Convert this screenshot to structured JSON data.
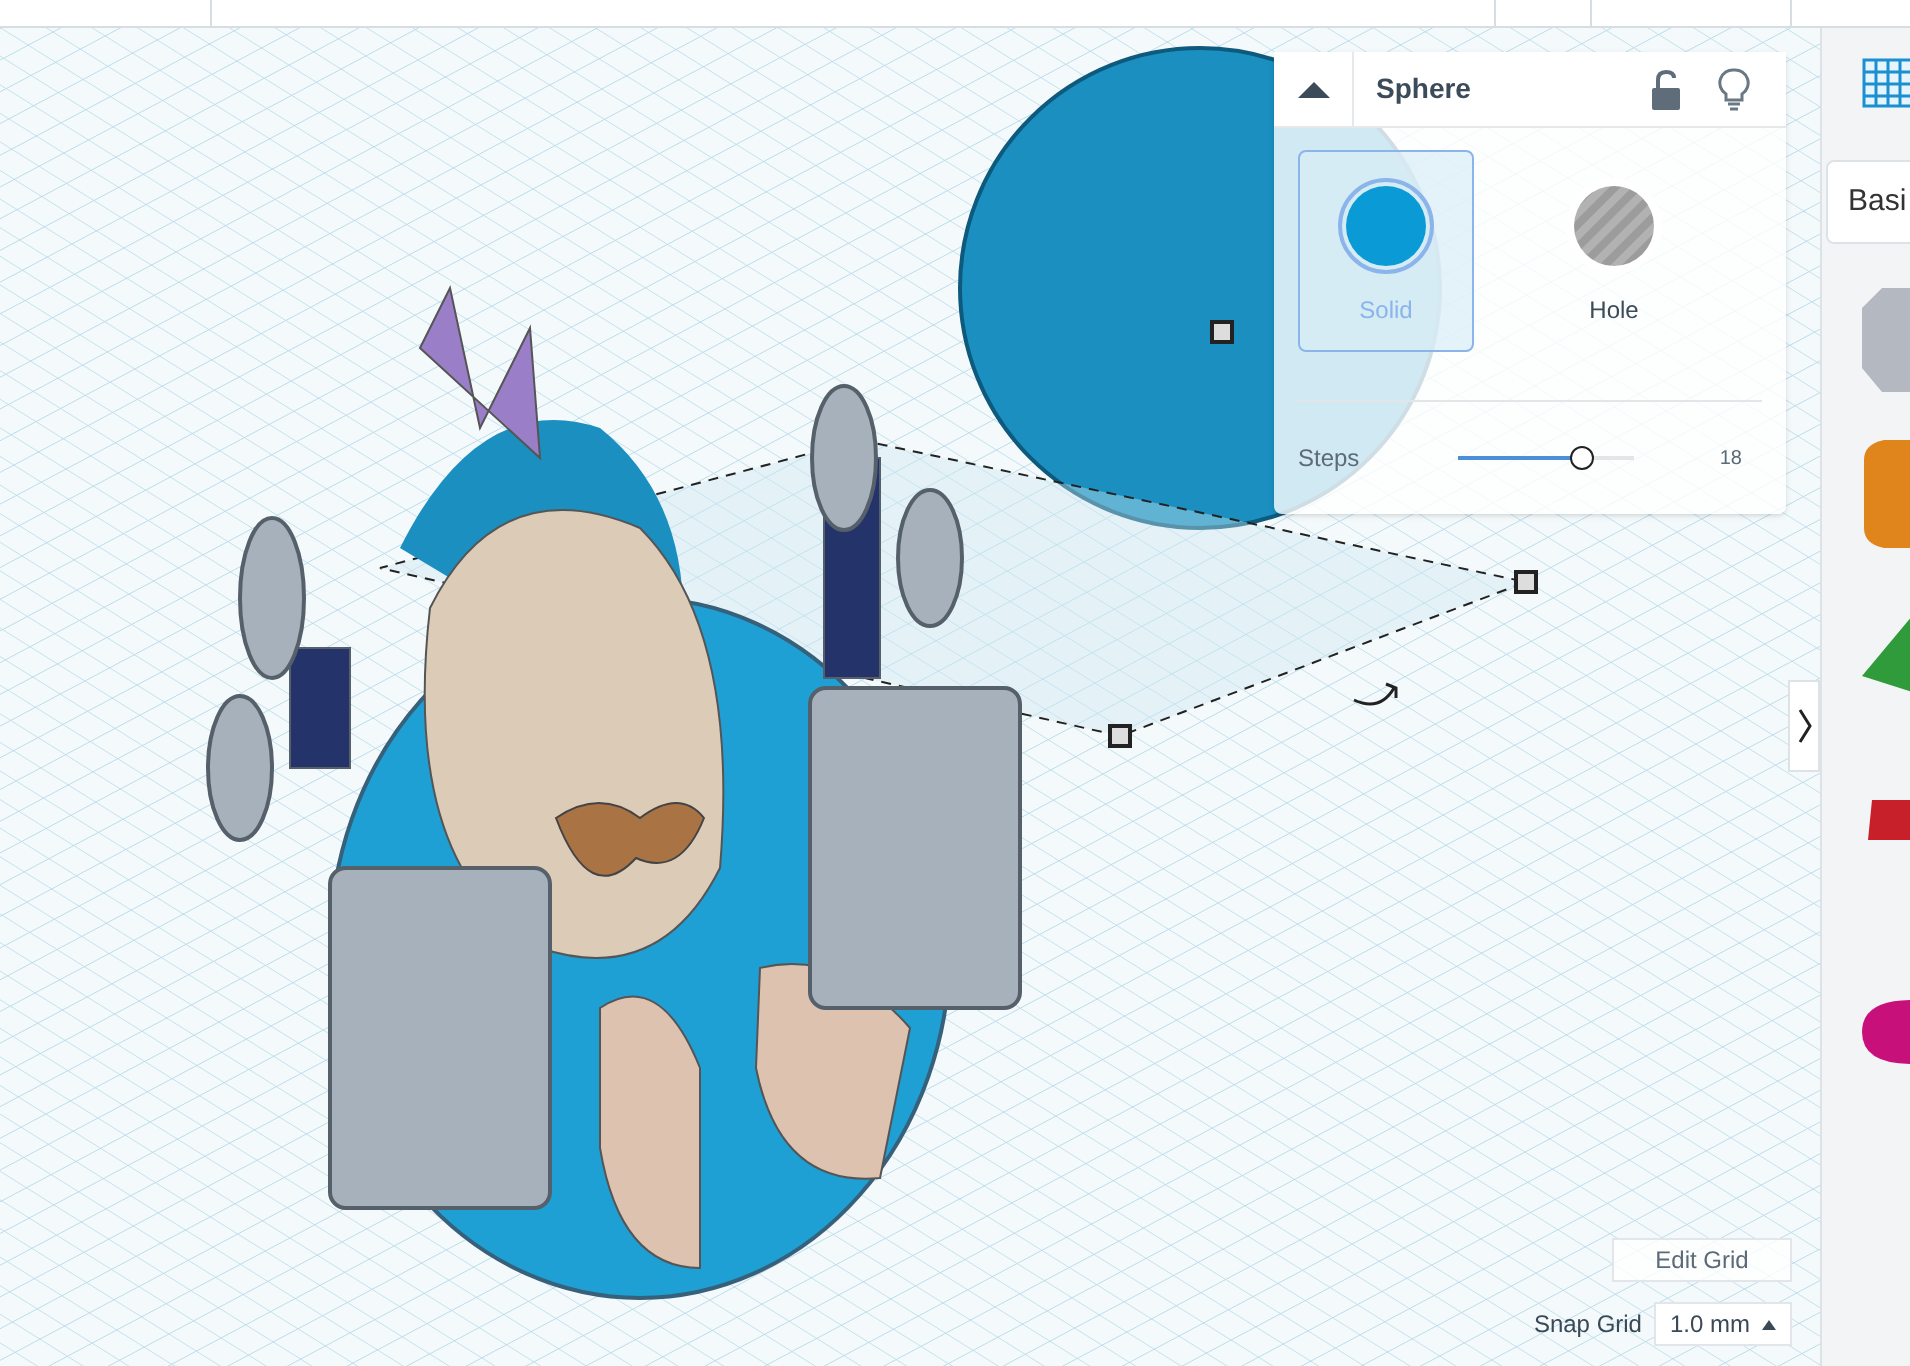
{
  "inspector": {
    "title": "Sphere",
    "collapsed": false,
    "locked": false,
    "options": [
      {
        "label": "Solid",
        "kind": "solid",
        "selected": true
      },
      {
        "label": "Hole",
        "kind": "hole",
        "selected": false
      }
    ],
    "steps": {
      "label": "Steps",
      "level": 0.71,
      "reading": "18"
    }
  },
  "library": {
    "category": "Basi"
  },
  "grid": {
    "edit_button": "Edit Grid",
    "snap_label": "Snap Grid",
    "snap_value": "1.0 mm"
  }
}
